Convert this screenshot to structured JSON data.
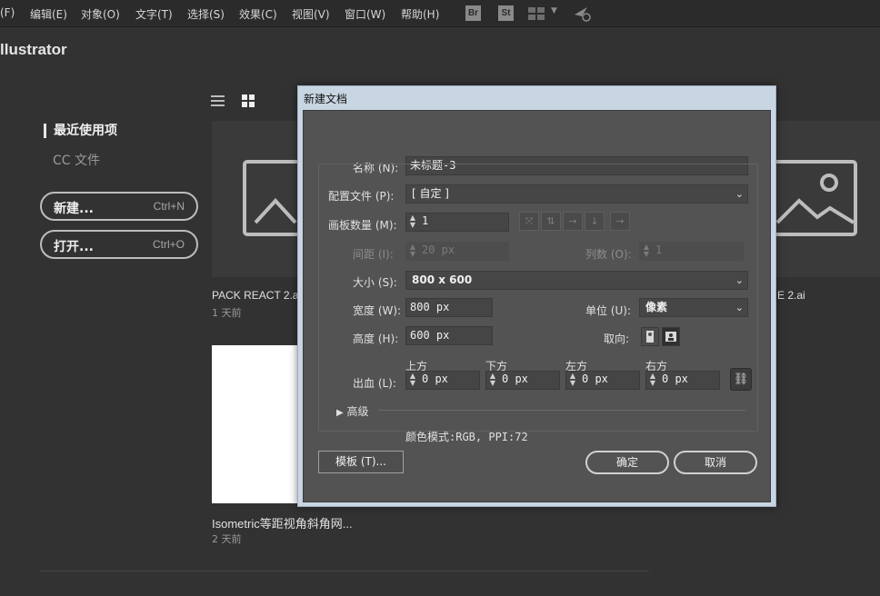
{
  "menubar": {
    "items": [
      "(F)",
      "编辑(E)",
      "对象(O)",
      "文字(T)",
      "选择(S)",
      "效果(C)",
      "视图(V)",
      "窗口(W)",
      "帮助(H)"
    ],
    "bridge": "Br",
    "stock": "St"
  },
  "app": {
    "title": "llustrator"
  },
  "nav": {
    "recent": "最近使用项",
    "cc_files": "CC 文件",
    "new_label": "新建...",
    "new_shortcut": "Ctrl+N",
    "open_label": "打开...",
    "open_shortcut": "Ctrl+O"
  },
  "files": [
    {
      "name": "PACK REACT 2.ai",
      "time": "1 天前"
    },
    {
      "name": "E 2.ai"
    },
    {
      "name": "Isometric等距视角斜角网...",
      "time": "2 天前"
    }
  ],
  "dialog": {
    "title": "新建文档",
    "name_label": "名称 (N):",
    "name_value": "未标题-3",
    "profile_label": "配置文件 (P):",
    "profile_value": "[ 自定 ]",
    "artboards_label": "画板数量 (M):",
    "artboards_value": "1",
    "spacing_label": "间距 (I):",
    "spacing_value": "20 px",
    "columns_label": "列数 (O):",
    "columns_value": "1",
    "size_label": "大小 (S):",
    "size_value": "800 x 600",
    "width_label": "宽度 (W):",
    "width_value": "800 px",
    "units_label": "单位 (U):",
    "units_value": "像素",
    "height_label": "高度 (H):",
    "height_value": "600 px",
    "orientation_label": "取向:",
    "bleed_label": "出血 (L):",
    "bleed_top_label": "上方",
    "bleed_bottom_label": "下方",
    "bleed_left_label": "左方",
    "bleed_right_label": "右方",
    "bleed_top": "0 px",
    "bleed_bottom": "0 px",
    "bleed_left": "0 px",
    "bleed_right": "0 px",
    "advanced_label": "高级",
    "color_mode": "颜色模式:RGB, PPI:72",
    "template_button": "模板 (T)...",
    "ok_button": "确定",
    "cancel_button": "取消"
  }
}
